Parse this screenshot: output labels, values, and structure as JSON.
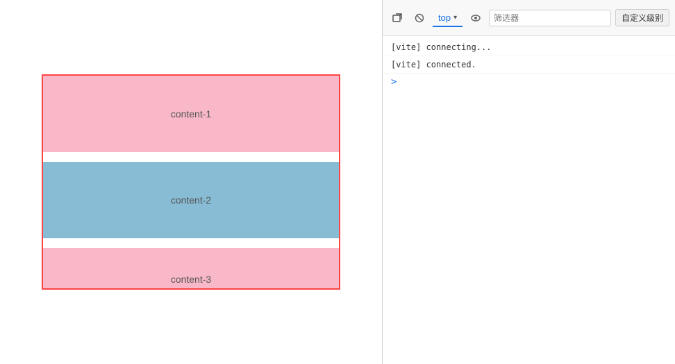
{
  "leftPanel": {
    "contents": [
      {
        "id": "content-1",
        "label": "content-1",
        "color": "#f8b8c8"
      },
      {
        "id": "content-2",
        "label": "content-2",
        "color": "#87bcd4"
      },
      {
        "id": "content-3",
        "label": "content-3",
        "color": "#f8b8c8"
      }
    ]
  },
  "devtools": {
    "toolbar": {
      "tabLabel": "top",
      "filterPlaceholder": "筛选器",
      "customLevelLabel": "自定义级别"
    },
    "console": {
      "lines": [
        {
          "text": "[vite] connecting..."
        },
        {
          "text": "[vite] connected."
        }
      ],
      "promptSymbol": ">"
    }
  }
}
